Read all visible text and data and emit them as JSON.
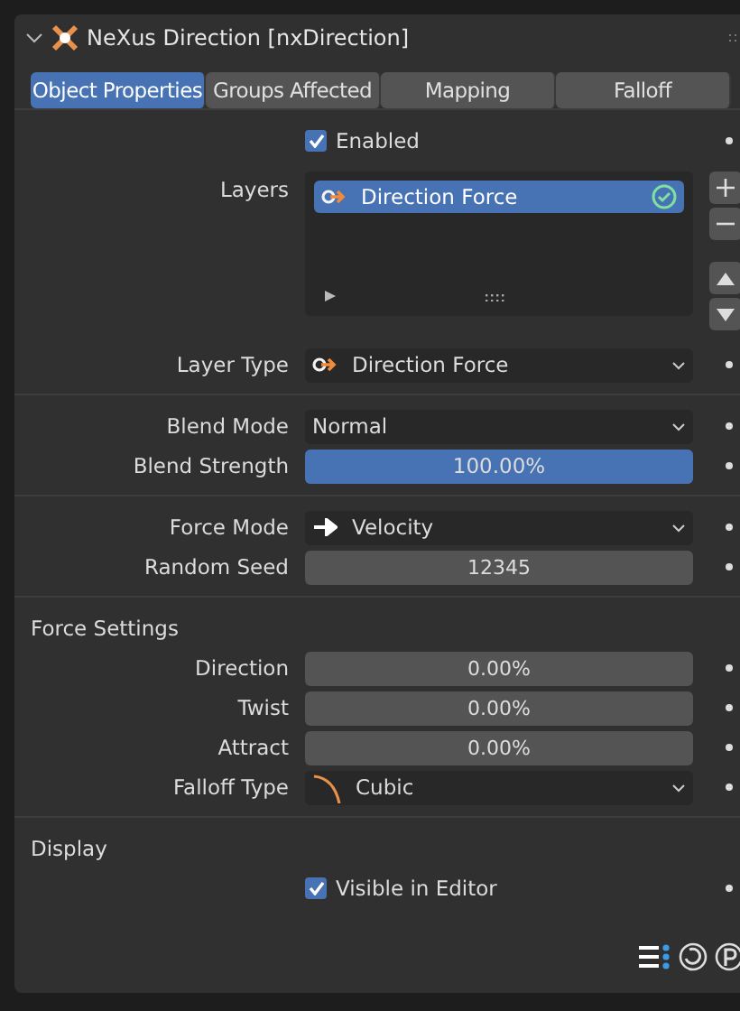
{
  "panel": {
    "title": "NeXus Direction [nxDirection]",
    "expanded": true
  },
  "tabs": [
    {
      "label": "Object Properties",
      "selected": true
    },
    {
      "label": "Groups Affected",
      "selected": false
    },
    {
      "label": "Mapping",
      "selected": false
    },
    {
      "label": "Falloff",
      "selected": false
    }
  ],
  "groups": [
    {
      "rows": [
        {
          "kind": "checkbox",
          "label": "Enabled",
          "checked": true
        },
        {
          "kind": "list",
          "label": "Layers",
          "items": [
            {
              "label": "Direction Force",
              "selected": true
            }
          ]
        },
        {
          "kind": "dropdown",
          "label": "Layer Type",
          "value": "Direction Force"
        }
      ]
    },
    {
      "rows": [
        {
          "kind": "dropdown",
          "label": "Blend Mode",
          "value": "Normal"
        },
        {
          "kind": "slider",
          "label": "Blend Strength",
          "value": "100.00%",
          "level": 1
        }
      ]
    },
    {
      "rows": [
        {
          "kind": "dropdown",
          "label": "Force Mode",
          "value": "Velocity"
        },
        {
          "kind": "number",
          "label": "Random Seed",
          "value": "12345"
        }
      ]
    },
    {
      "heading": "Force Settings",
      "rows": [
        {
          "kind": "number",
          "label": "Direction",
          "value": "0.00%"
        },
        {
          "kind": "number",
          "label": "Twist",
          "value": "0.00%"
        },
        {
          "kind": "number",
          "label": "Attract",
          "value": "0.00%"
        },
        {
          "kind": "dropdown",
          "label": "Falloff Type",
          "value": "Cubic"
        }
      ]
    },
    {
      "heading": "Display",
      "rows": [
        {
          "kind": "checkbox",
          "label": "Visible in Editor",
          "checked": true
        }
      ]
    }
  ]
}
